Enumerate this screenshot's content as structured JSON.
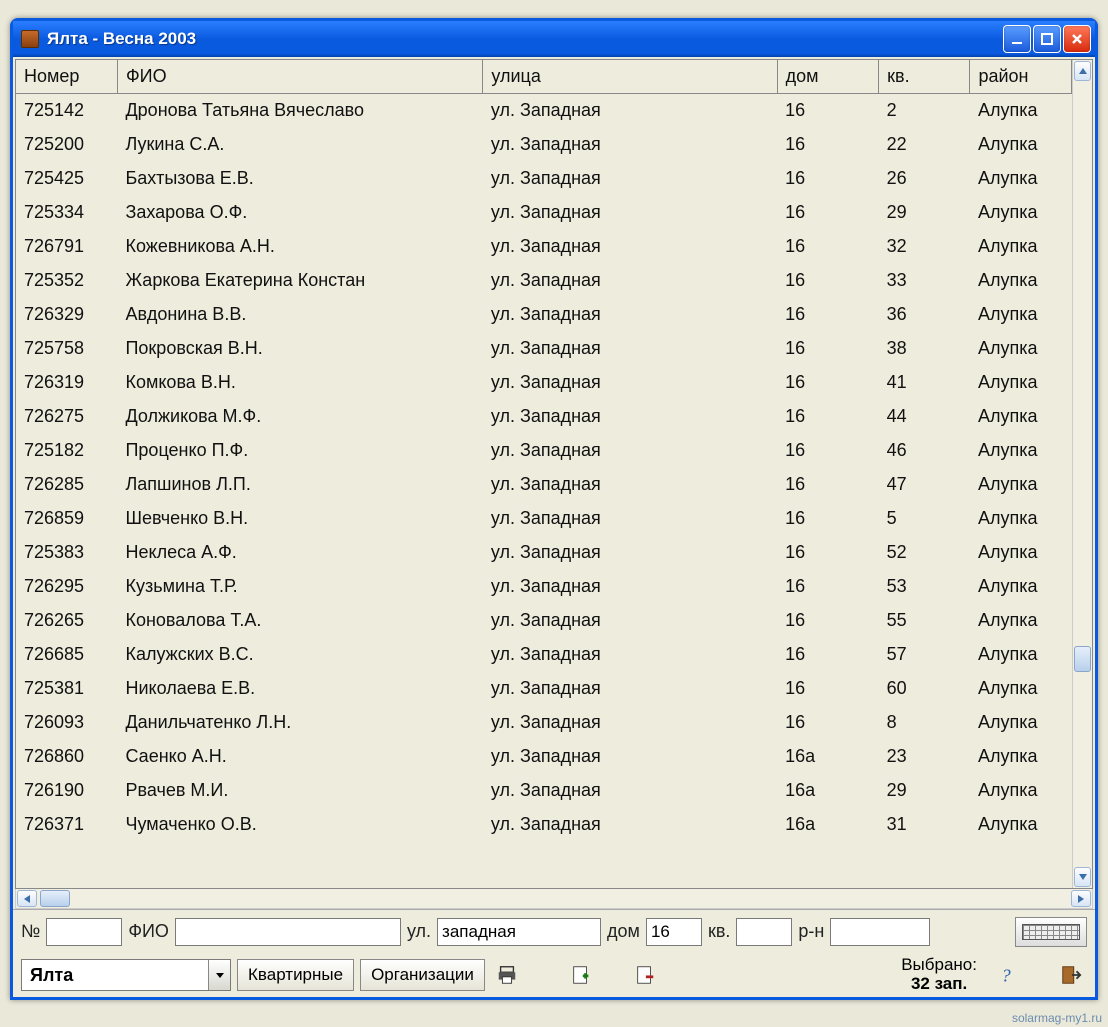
{
  "window": {
    "title": "Ялта  - Весна 2003"
  },
  "table": {
    "columns": [
      "Номер",
      "ФИО",
      "улица",
      "дом",
      "кв.",
      "район"
    ],
    "rows": [
      {
        "nomer": "725142",
        "fio": "Дронова Татьяна Вячеславо",
        "ulica": "ул. Западная",
        "dom": "16",
        "kv": "2",
        "rayon": "Алупка"
      },
      {
        "nomer": "725200",
        "fio": "Лукина С.А.",
        "ulica": "ул. Западная",
        "dom": "16",
        "kv": "22",
        "rayon": "Алупка"
      },
      {
        "nomer": "725425",
        "fio": "Бахтызова Е.В.",
        "ulica": "ул. Западная",
        "dom": "16",
        "kv": "26",
        "rayon": "Алупка"
      },
      {
        "nomer": "725334",
        "fio": "Захарова О.Ф.",
        "ulica": "ул. Западная",
        "dom": "16",
        "kv": "29",
        "rayon": "Алупка"
      },
      {
        "nomer": "726791",
        "fio": "Кожевникова А.Н.",
        "ulica": "ул. Западная",
        "dom": "16",
        "kv": "32",
        "rayon": "Алупка"
      },
      {
        "nomer": "725352",
        "fio": "Жаркова Екатерина Констан",
        "ulica": "ул. Западная",
        "dom": "16",
        "kv": "33",
        "rayon": "Алупка"
      },
      {
        "nomer": "726329",
        "fio": "Авдонина В.В.",
        "ulica": "ул. Западная",
        "dom": "16",
        "kv": "36",
        "rayon": "Алупка"
      },
      {
        "nomer": "725758",
        "fio": "Покровская В.Н.",
        "ulica": "ул. Западная",
        "dom": "16",
        "kv": "38",
        "rayon": "Алупка"
      },
      {
        "nomer": "726319",
        "fio": "Комкова В.Н.",
        "ulica": "ул. Западная",
        "dom": "16",
        "kv": "41",
        "rayon": "Алупка"
      },
      {
        "nomer": "726275",
        "fio": "Должикова М.Ф.",
        "ulica": "ул. Западная",
        "dom": "16",
        "kv": "44",
        "rayon": "Алупка"
      },
      {
        "nomer": "725182",
        "fio": "Проценко П.Ф.",
        "ulica": "ул. Западная",
        "dom": "16",
        "kv": "46",
        "rayon": "Алупка"
      },
      {
        "nomer": "726285",
        "fio": "Лапшинов Л.П.",
        "ulica": "ул. Западная",
        "dom": "16",
        "kv": "47",
        "rayon": "Алупка"
      },
      {
        "nomer": "726859",
        "fio": "Шевченко В.Н.",
        "ulica": "ул. Западная",
        "dom": "16",
        "kv": "5",
        "rayon": "Алупка"
      },
      {
        "nomer": "725383",
        "fio": "Неклеса А.Ф.",
        "ulica": "ул. Западная",
        "dom": "16",
        "kv": "52",
        "rayon": "Алупка"
      },
      {
        "nomer": "726295",
        "fio": "Кузьмина Т.Р.",
        "ulica": "ул. Западная",
        "dom": "16",
        "kv": "53",
        "rayon": "Алупка"
      },
      {
        "nomer": "726265",
        "fio": "Коновалова Т.А.",
        "ulica": "ул. Западная",
        "dom": "16",
        "kv": "55",
        "rayon": "Алупка"
      },
      {
        "nomer": "726685",
        "fio": "Калужских В.С.",
        "ulica": "ул. Западная",
        "dom": "16",
        "kv": "57",
        "rayon": "Алупка"
      },
      {
        "nomer": "725381",
        "fio": "Николаева Е.В.",
        "ulica": "ул. Западная",
        "dom": "16",
        "kv": "60",
        "rayon": "Алупка"
      },
      {
        "nomer": "726093",
        "fio": "Данильчатенко Л.Н.",
        "ulica": "ул. Западная",
        "dom": "16",
        "kv": "8",
        "rayon": "Алупка"
      },
      {
        "nomer": "726860",
        "fio": "Саенко А.Н.",
        "ulica": "ул. Западная",
        "dom": "16а",
        "kv": "23",
        "rayon": "Алупка"
      },
      {
        "nomer": "726190",
        "fio": "Рвачев М.И.",
        "ulica": "ул. Западная",
        "dom": "16а",
        "kv": "29",
        "rayon": "Алупка"
      },
      {
        "nomer": "726371",
        "fio": "Чумаченко О.В.",
        "ulica": "ул. Западная",
        "dom": "16а",
        "kv": "31",
        "rayon": "Алупка"
      }
    ]
  },
  "search": {
    "labels": {
      "nomer": "№",
      "fio": "ФИО",
      "ulica": "ул.",
      "dom": "дом",
      "kv": "кв.",
      "rayon": "р-н"
    },
    "values": {
      "nomer": "",
      "fio": "",
      "ulica": "западная",
      "dom": "16",
      "kv": "",
      "rayon": ""
    }
  },
  "toolbar": {
    "city": "Ялта",
    "kvartirnye": "Квартирные",
    "organizacii": "Организации",
    "status_label": "Выбрано:",
    "status_value": "32 зап."
  },
  "footer": "solarmag-my1.ru"
}
